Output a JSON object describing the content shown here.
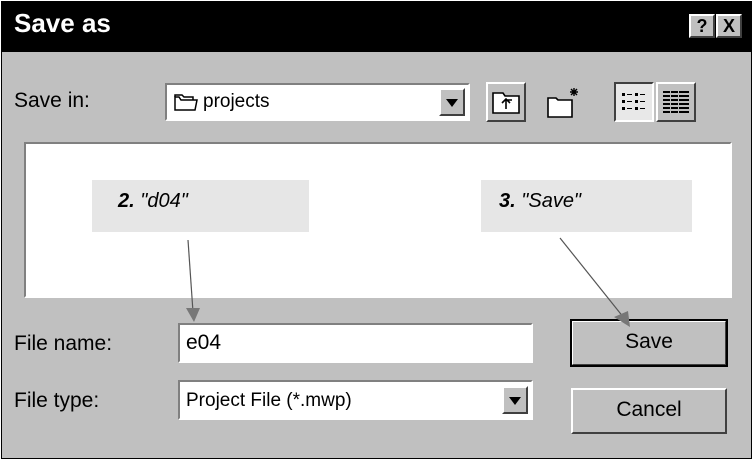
{
  "window": {
    "title": "Save as",
    "help_label": "?",
    "close_label": "X"
  },
  "toolbar": {
    "save_in_label": "Save in:",
    "folder_name": "projects",
    "up_icon": "up-folder-icon",
    "new_folder_icon": "new-folder-icon",
    "list_view_icon": "list-view-icon",
    "details_view_icon": "details-view-icon"
  },
  "callouts": {
    "step2_number": "2.",
    "step2_text": "\"d04\"",
    "step3_number": "3.",
    "step3_text": "\"Save\""
  },
  "form": {
    "file_name_label": "File name:",
    "file_name_value": "e04",
    "file_type_label": "File type:",
    "file_type_value": "Project File (*.mwp)"
  },
  "buttons": {
    "save_label": "Save",
    "cancel_label": "Cancel"
  }
}
